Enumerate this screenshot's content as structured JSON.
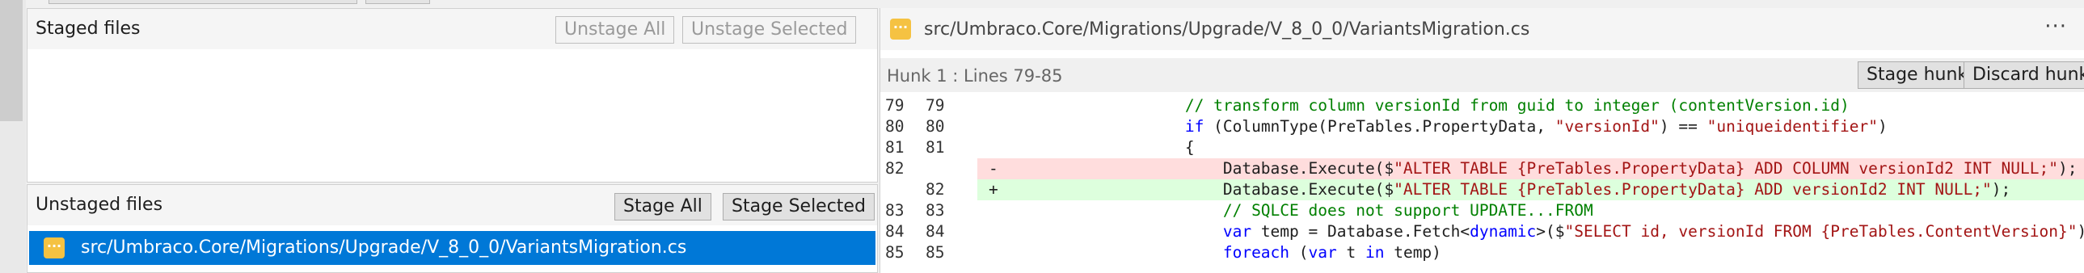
{
  "staged": {
    "title": "Staged files",
    "unstage_all_label": "Unstage All",
    "unstage_selected_label": "Unstage Selected"
  },
  "unstaged": {
    "title": "Unstaged files",
    "stage_all_label": "Stage All",
    "stage_selected_label": "Stage Selected",
    "files": [
      {
        "path": "src/Umbraco.Core/Migrations/Upgrade/V_8_0_0/VariantsMigration.cs",
        "icon": "modified-file-icon",
        "selected": true
      }
    ]
  },
  "diff": {
    "file_path": "src/Umbraco.Core/Migrations/Upgrade/V_8_0_0/VariantsMigration.cs",
    "file_icon": "modified-file-icon",
    "more_label": "···",
    "hunk_label": "Hunk 1 : Lines 79-85",
    "stage_hunk_label": "Stage hunk",
    "discard_hunk_label": "Discard hunk",
    "lines": [
      {
        "old": "79",
        "new": "79",
        "marker": "",
        "type": "context",
        "tokens": [
          {
            "t": "            ",
            "k": "plain"
          },
          {
            "t": "// transform column versionId from guid to integer (contentVersion.id)",
            "k": "comment"
          }
        ]
      },
      {
        "old": "80",
        "new": "80",
        "marker": "",
        "type": "context",
        "tokens": [
          {
            "t": "            ",
            "k": "plain"
          },
          {
            "t": "if",
            "k": "keyword"
          },
          {
            "t": " (ColumnType(PreTables.PropertyData, ",
            "k": "plain"
          },
          {
            "t": "\"versionId\"",
            "k": "string"
          },
          {
            "t": ") == ",
            "k": "plain"
          },
          {
            "t": "\"uniqueidentifier\"",
            "k": "string"
          },
          {
            "t": ")",
            "k": "plain"
          }
        ]
      },
      {
        "old": "81",
        "new": "81",
        "marker": "",
        "type": "context",
        "tokens": [
          {
            "t": "            {",
            "k": "plain"
          }
        ]
      },
      {
        "old": "82",
        "new": "",
        "marker": "-",
        "type": "removed",
        "tokens": [
          {
            "t": "                Database.Execute($",
            "k": "plain"
          },
          {
            "t": "\"ALTER TABLE {PreTables.PropertyData} ADD COLUMN versionId2 INT NULL;\"",
            "k": "string"
          },
          {
            "t": ");",
            "k": "plain"
          }
        ]
      },
      {
        "old": "",
        "new": "82",
        "marker": "+",
        "type": "added",
        "tokens": [
          {
            "t": "                Database.Execute($",
            "k": "plain"
          },
          {
            "t": "\"ALTER TABLE {PreTables.PropertyData} ADD versionId2 INT NULL;\"",
            "k": "string"
          },
          {
            "t": ");",
            "k": "plain"
          }
        ]
      },
      {
        "old": "83",
        "new": "83",
        "marker": "",
        "type": "context",
        "tokens": [
          {
            "t": "                ",
            "k": "plain"
          },
          {
            "t": "// SQLCE does not support UPDATE...FROM",
            "k": "comment"
          }
        ]
      },
      {
        "old": "84",
        "new": "84",
        "marker": "",
        "type": "context",
        "tokens": [
          {
            "t": "                ",
            "k": "plain"
          },
          {
            "t": "var",
            "k": "keyword"
          },
          {
            "t": " temp = Database.Fetch<",
            "k": "plain"
          },
          {
            "t": "dynamic",
            "k": "keyword"
          },
          {
            "t": ">($",
            "k": "plain"
          },
          {
            "t": "\"SELECT id, versionId FROM {PreTables.ContentVersion}\"",
            "k": "string"
          },
          {
            "t": ");",
            "k": "plain"
          }
        ]
      },
      {
        "old": "85",
        "new": "85",
        "marker": "",
        "type": "context",
        "tokens": [
          {
            "t": "                ",
            "k": "plain"
          },
          {
            "t": "foreach",
            "k": "keyword"
          },
          {
            "t": " (",
            "k": "plain"
          },
          {
            "t": "var",
            "k": "keyword"
          },
          {
            "t": " t ",
            "k": "plain"
          },
          {
            "t": "in",
            "k": "keyword"
          },
          {
            "t": " temp)",
            "k": "plain"
          }
        ]
      }
    ]
  }
}
